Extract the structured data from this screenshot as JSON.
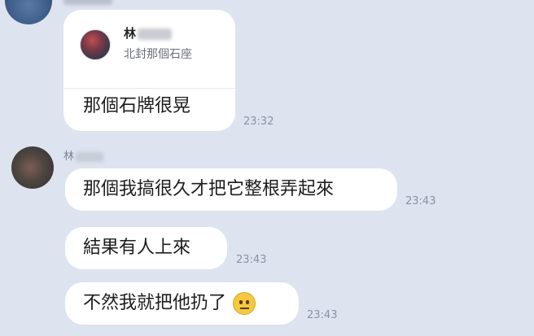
{
  "messages": {
    "reply": {
      "quote_name": "林",
      "quote_text": "北封那個石座",
      "text": "那個石牌很晃",
      "time": "23:32"
    },
    "sender_name": "林",
    "m2": {
      "text": "那個我搞很久才把它整根弄起來",
      "time": "23:43"
    },
    "m3": {
      "text": "結果有人上來",
      "time": "23:43"
    },
    "m4": {
      "text": "不然我就把他扔了",
      "emoji": "neutral-face-emoji",
      "time": "23:43"
    }
  }
}
